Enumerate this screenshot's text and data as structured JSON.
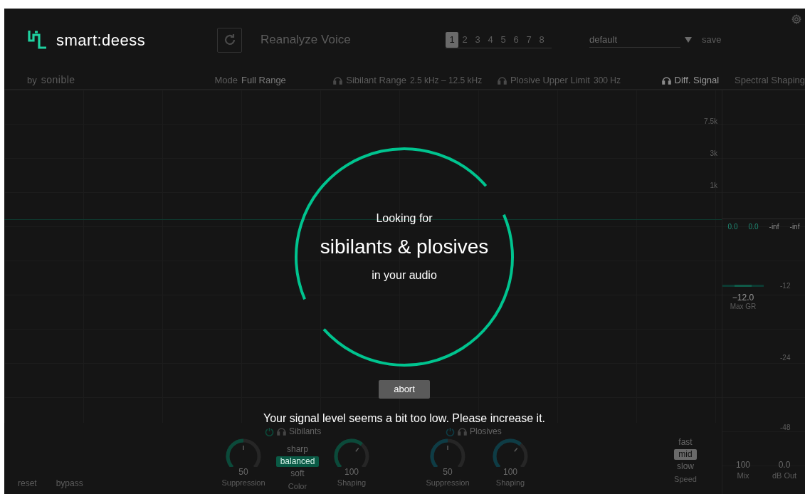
{
  "header": {
    "logo": "smart:deess",
    "reanalyze": "Reanalyze Voice",
    "slots": [
      {
        "label": "1",
        "selected": true
      },
      {
        "label": "2",
        "selected": false
      },
      {
        "label": "3",
        "selected": false
      },
      {
        "label": "4",
        "selected": false
      },
      {
        "label": "5",
        "selected": false
      },
      {
        "label": "6",
        "selected": false
      },
      {
        "label": "7",
        "selected": false
      },
      {
        "label": "8",
        "selected": false
      }
    ],
    "preset": "default",
    "save": "save"
  },
  "subheader": {
    "by": "by",
    "brand": "sonible",
    "mode_label": "Mode",
    "mode_value": "Full Range",
    "params": [
      {
        "label": "Sibilant Range",
        "value": "2.5 kHz – 12.5 kHz",
        "on": false
      },
      {
        "label": "Plosive Upper Limit",
        "value": "300 Hz",
        "on": false
      },
      {
        "label": "Diff. Signal",
        "on": true
      }
    ],
    "spectral": "Spectral Shaping"
  },
  "graph": {
    "freq_labels": [
      "7.5k",
      "3k",
      "1k"
    ]
  },
  "meters": {
    "readings": [
      {
        "text": "0.0",
        "kind": "gain"
      },
      {
        "text": "0.0",
        "kind": "gain"
      },
      {
        "text": "-inf",
        "kind": "level"
      },
      {
        "text": "-inf",
        "kind": "level"
      }
    ],
    "db_labels": [
      "-12",
      "-24",
      "-48"
    ],
    "max_gr": "−12.0",
    "max_gr_label": "Max GR",
    "mix": "100",
    "mix_label": "Mix",
    "out": "0.0",
    "out_label": "dB Out"
  },
  "overlay": {
    "line1": "Looking for",
    "title": "sibilants & plosives",
    "line3": "in your audio",
    "button": "abort",
    "message": "Your signal level seems a bit too low. Please increase it."
  },
  "sections": [
    {
      "title": "Sibilants",
      "on": true,
      "color": "#0b4a3a",
      "knobs": [
        {
          "value": "50",
          "label": "Suppression",
          "level": 0.5
        },
        {
          "value": "100",
          "label": "Shaping",
          "level": 0.65
        }
      ],
      "options": [
        {
          "label": "sharp",
          "selected": false
        },
        {
          "label": "balanced",
          "selected": true
        },
        {
          "label": "soft",
          "selected": false
        }
      ],
      "options_label": "Color"
    },
    {
      "title": "Plosives",
      "on": true,
      "color": "#0e3c45",
      "knobs": [
        {
          "value": "50",
          "label": "Suppression",
          "level": 0.5
        },
        {
          "value": "100",
          "label": "Shaping",
          "level": 0.65
        }
      ]
    }
  ],
  "speed": {
    "options": [
      {
        "label": "fast",
        "selected": false
      },
      {
        "label": "mid",
        "selected": true
      },
      {
        "label": "slow",
        "selected": false
      }
    ],
    "label": "Speed"
  },
  "footer": {
    "reset": "reset",
    "bypass": "bypass"
  }
}
